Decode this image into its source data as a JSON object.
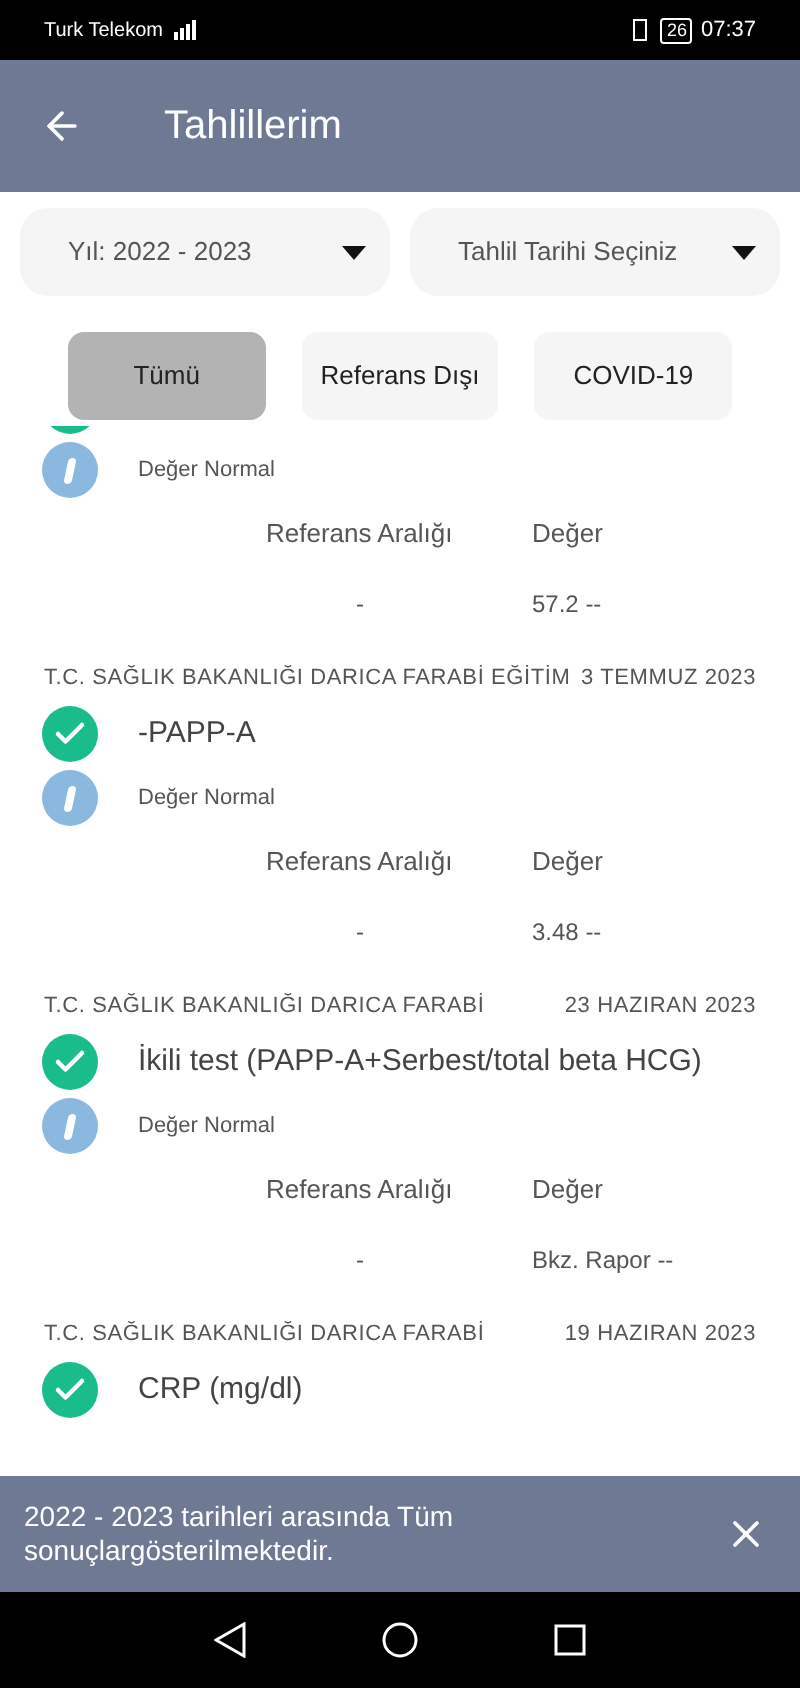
{
  "status_bar": {
    "carrier": "Turk Telekom",
    "battery": "26",
    "time": "07:37"
  },
  "app_bar": {
    "title": "Tahlillerim"
  },
  "filters": [
    {
      "value": "Yıl: 2022 - 2023"
    },
    {
      "value": "Tahlil Tarihi Seçiniz"
    }
  ],
  "tabs": [
    {
      "label": "Tümü",
      "selected": true
    },
    {
      "label": "Referans Dışı",
      "selected": false
    },
    {
      "label": "COVID-19",
      "selected": false
    }
  ],
  "results": [
    {
      "normal": true,
      "note": "Değer Normal",
      "columns": [
        "Referans Aralığı",
        "Değer"
      ],
      "values": [
        "-",
        "57.2 --"
      ]
    },
    {
      "hospital": "T.C. SAĞLIK BAKANLIĞI DARICA FARABİ EĞİTİM",
      "date": "3 TEMMUZ 2023",
      "normal": true,
      "title": "-PAPP-A",
      "note": "Değer Normal",
      "columns": [
        "Referans Aralığı",
        "Değer"
      ],
      "values": [
        "-",
        "3.48 --"
      ]
    },
    {
      "hospital": "T.C. SAĞLIK BAKANLIĞI DARICA FARABİ",
      "date": "23 HAZIRAN 2023",
      "normal": true,
      "title": "İkili test (PAPP-A+Serbest/total beta HCG)",
      "note": "Değer Normal",
      "columns": [
        "Referans Aralığı",
        "Değer"
      ],
      "values": [
        "-",
        "Bkz. Rapor --"
      ]
    },
    {
      "hospital": "T.C. SAĞLIK BAKANLIĞI DARICA FARABİ",
      "date": "19 HAZIRAN 2023",
      "normal": true,
      "title": "CRP (mg/dl)"
    }
  ],
  "snackbar": {
    "message": "2022 - 2023 tarihleri arasında Tüm sonuçlargösterilmektedir."
  }
}
